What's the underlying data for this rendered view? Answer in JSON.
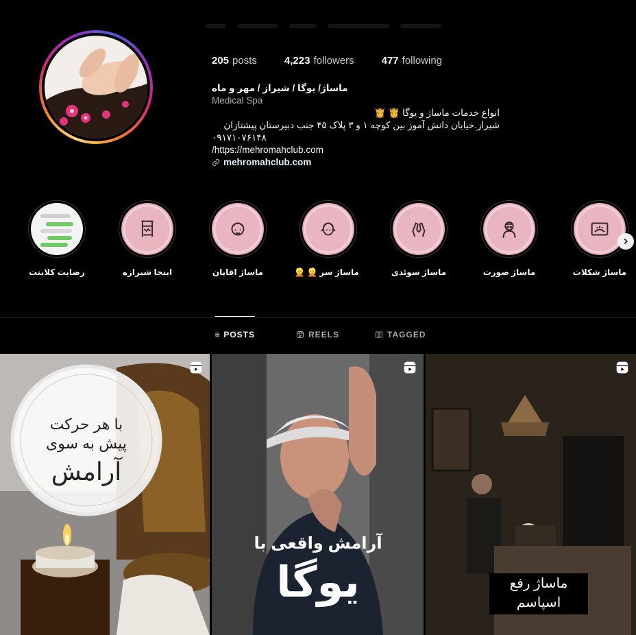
{
  "profile": {
    "stats": [
      {
        "value": "205",
        "label": "posts"
      },
      {
        "value": "4,223",
        "label": "followers"
      },
      {
        "value": "477",
        "label": "following"
      }
    ],
    "name": "ماساژ/ یوگا / شیراز / مهر و ماه",
    "category": "Medical Spa",
    "bio_line1": "انواع خدمات ماساژ و یوگا 👸 👸",
    "bio_line2": "شیراز.خیابان دانش آموز بین کوچه ۱ و ۳ پلاک ۴۵ جنب دبیرستان پیشتازان",
    "bio_phone": "۰۹۱۷۱۰۷۶۱۴۸",
    "bio_url": "/https://mehromahclub.com",
    "link": "mehromahclub.com"
  },
  "highlights": [
    {
      "label": "رضایت کلاینت",
      "icon": "chat-screenshot"
    },
    {
      "label": "اینجا شیرازه",
      "icon": "gate-icon"
    },
    {
      "label": "ماساژ اقایان",
      "icon": "man-face-icon"
    },
    {
      "label": "ماساژ سر 👱 👱",
      "icon": "head-massage-icon"
    },
    {
      "label": "ماساژ سوئدی",
      "icon": "hands-icon"
    },
    {
      "label": "ماساژ صورت",
      "icon": "face-mask-icon"
    },
    {
      "label": "ماساژ شکلات",
      "icon": "spa-bath-icon"
    }
  ],
  "tabs": [
    {
      "label": "POSTS",
      "icon": "grid-icon",
      "active": true
    },
    {
      "label": "REELS",
      "icon": "reels-icon",
      "active": false
    },
    {
      "label": "TAGGED",
      "icon": "tag-icon",
      "active": false
    }
  ],
  "posts": [
    {
      "line1": "با هر حرکت",
      "line2": "پیش به سوی",
      "line3": "آرامش"
    },
    {
      "line1": "آرامش واقعی با",
      "line2": "یوگا"
    },
    {
      "line1": "ماساژ رفع",
      "line2": "اسپاسم"
    }
  ],
  "colors": {
    "background": "#000000",
    "text": "#f5f5f5",
    "muted": "#a8a8a8",
    "link": "#e0f1ff"
  }
}
